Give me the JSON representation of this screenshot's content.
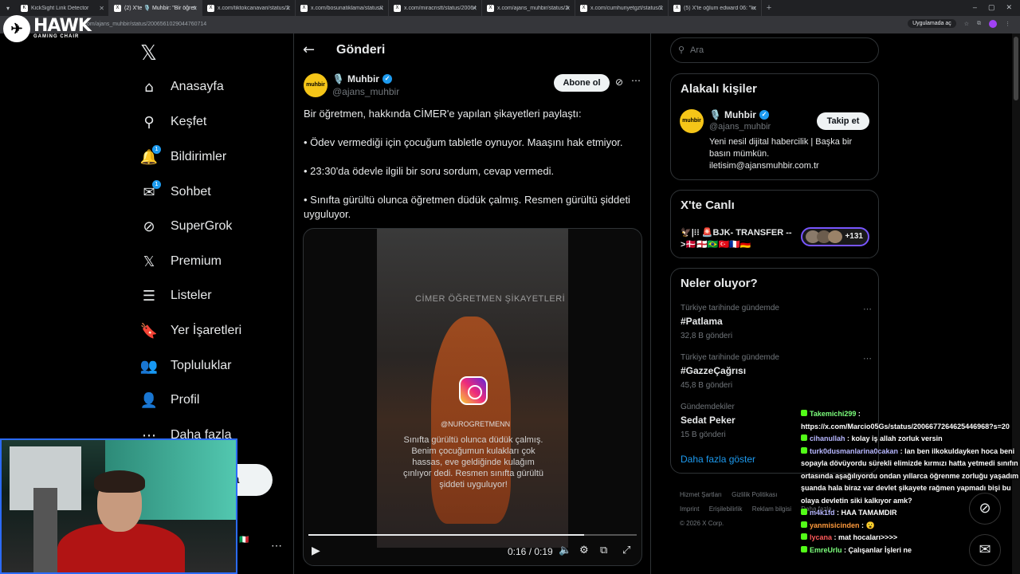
{
  "browser": {
    "tabs": [
      {
        "title": "KickSight Link Detector",
        "fav": "K"
      },
      {
        "title": "(2) X'te 🎙️ Muhbir: \"Bir öğretmen",
        "fav": "X",
        "active": true
      },
      {
        "title": "x.com/tiktokcanavari/status/20",
        "fav": "X"
      },
      {
        "title": "x.com/bosunatiklama/status/20",
        "fav": "X"
      },
      {
        "title": "x.com/miracristt/status/20064",
        "fav": "X"
      },
      {
        "title": "x.com/ajans_muhbir/status/20",
        "fav": "X"
      },
      {
        "title": "x.com/cumhuriyetgzt/status/20",
        "fav": "X"
      },
      {
        "title": "(5) X'te oğlum edward 06: \"ken",
        "fav": "X"
      }
    ],
    "url": "x.com/ajans_muhbir/status/2006561029044760714",
    "open_in_app": "Uygulamada aç"
  },
  "overlay": {
    "brand": "HAWK",
    "brand_sub": "GAMING CHAIR"
  },
  "nav": {
    "items": [
      {
        "label": "Anasayfa",
        "icon": "home-icon",
        "glyph": "⌂"
      },
      {
        "label": "Keşfet",
        "icon": "search-icon",
        "glyph": "⚲"
      },
      {
        "label": "Bildirimler",
        "icon": "bell-icon",
        "glyph": "🔔",
        "badge": "1"
      },
      {
        "label": "Sohbet",
        "icon": "mail-icon",
        "glyph": "✉",
        "badge": "1"
      },
      {
        "label": "SuperGrok",
        "icon": "grok-icon",
        "glyph": "⊘"
      },
      {
        "label": "Premium",
        "icon": "x-icon",
        "glyph": "𝕏"
      },
      {
        "label": "Listeler",
        "icon": "list-icon",
        "glyph": "☰"
      },
      {
        "label": "Yer İşaretleri",
        "icon": "bookmark-icon",
        "glyph": "🔖"
      },
      {
        "label": "Topluluklar",
        "icon": "communities-icon",
        "glyph": "👥"
      },
      {
        "label": "Profil",
        "icon": "profile-icon",
        "glyph": "👤"
      },
      {
        "label": "Daha fazla",
        "icon": "more-icon",
        "glyph": "⋯"
      }
    ],
    "post_button": "a"
  },
  "main": {
    "header": "Gönderi",
    "author": {
      "name": "Muhbir",
      "handle": "@ajans_muhbir",
      "avatar_text": "muhbir"
    },
    "subscribe": "Abone ol",
    "text": [
      "Bir öğretmen, hakkında CİMER'e yapılan şikayetleri paylaştı:",
      "• Ödev vermediği için çocuğum tabletle oynuyor. Maaşını hak etmiyor.",
      "•  23:30'da ödevle ilgili bir soru sordum, cevap vermedi.",
      "•  Sınıfta gürültü olunca öğretmen düdük çalmış. Resmen gürültü şiddeti uyguluyor."
    ],
    "video": {
      "caption": "CİMER ÖĞRETMEN ŞİKAYETLERİ",
      "ig_handle": "@NUROGRETMENN",
      "subtitle": "Sınıfta gürültü olunca düdük çalmış. Benim çocuğumun kulakları çok hassas, eve geldiğinde kulağım çınlıyor dedi. Resmen sınıfta gürültü şiddeti uyguluyor!",
      "time": "0:16 / 0:19",
      "progress": 0.84
    }
  },
  "sidebar": {
    "search_placeholder": "Ara",
    "related": {
      "title": "Alakalı kişiler",
      "name": "Muhbir",
      "handle": "@ajans_muhbir",
      "follow": "Takip et",
      "bio": "Yeni nesil dijital habercilik | Başka bir basın mümkün. iletisim@ajansmuhbir.com.tr"
    },
    "live": {
      "title": "X'te Canlı",
      "text": "🦅|⁝⁝ 🚨BJK- TRANSFER -->🇩🇰🏴󠁧󠁢󠁥󠁮󠁧󠁿🇧🇷🇹🇷🇫🇷🇩🇪",
      "count": "+131"
    },
    "trends": {
      "title": "Neler oluyor?",
      "items": [
        {
          "category": "Türkiye tarihinde gündemde",
          "name": "#Patlama",
          "count": "32,8 B gönderi"
        },
        {
          "category": "Türkiye tarihinde gündemde",
          "name": "#GazzeÇağrısı",
          "count": "45,8 B gönderi"
        },
        {
          "category": "Gündemdekiler",
          "name": "Sedat Peker",
          "count": "15 B gönderi"
        }
      ],
      "show_more": "Daha fazla göster"
    },
    "footer": {
      "links1": [
        "Hizmet Şartları",
        "Gizlilik Politikası"
      ],
      "links2": [
        "Imprint",
        "Erişilebilirlik",
        "Reklam bilgisi",
        "Daha fazla ..."
      ],
      "copyright": "© 2026 X Corp."
    }
  },
  "chat": {
    "messages": [
      {
        "user": "Takemichi299",
        "color": "#7cff7c",
        "text": "https://x.com/Marcio05Gs/status/2006677264625446968?s=20"
      },
      {
        "user": "cihanullah",
        "color": "#b7b7ff",
        "text": "kolay iş allah zorluk versin"
      },
      {
        "user": "turk0dusmanlarina0cakan",
        "color": "#b7b7ff",
        "text": "lan ben ilkokuldayken hoca beni sopayla dövüyordu sürekli elimizde kırmızı hatta yetmedi sınıfın ortasında aşağılıyordu ondan yıllarca öğrenme zorluğu yaşadım şuanda hala biraz var devlet şikayete rağmen yapmadı bişi bu olaya devletin siki kalkıyor amk?"
      },
      {
        "user": "m4k1fd",
        "color": "#b7b7ff",
        "text": "HAA TAMAMDIR"
      },
      {
        "user": "yanmisicinden",
        "color": "#ff9a3c",
        "text": "😮"
      },
      {
        "user": "lycana",
        "color": "#ff5a5a",
        "text": "mat hocaları>>>>"
      },
      {
        "user": "EmreUrlu",
        "color": "#7cff7c",
        "text": "Çalışanlar İşleri ne"
      }
    ]
  }
}
